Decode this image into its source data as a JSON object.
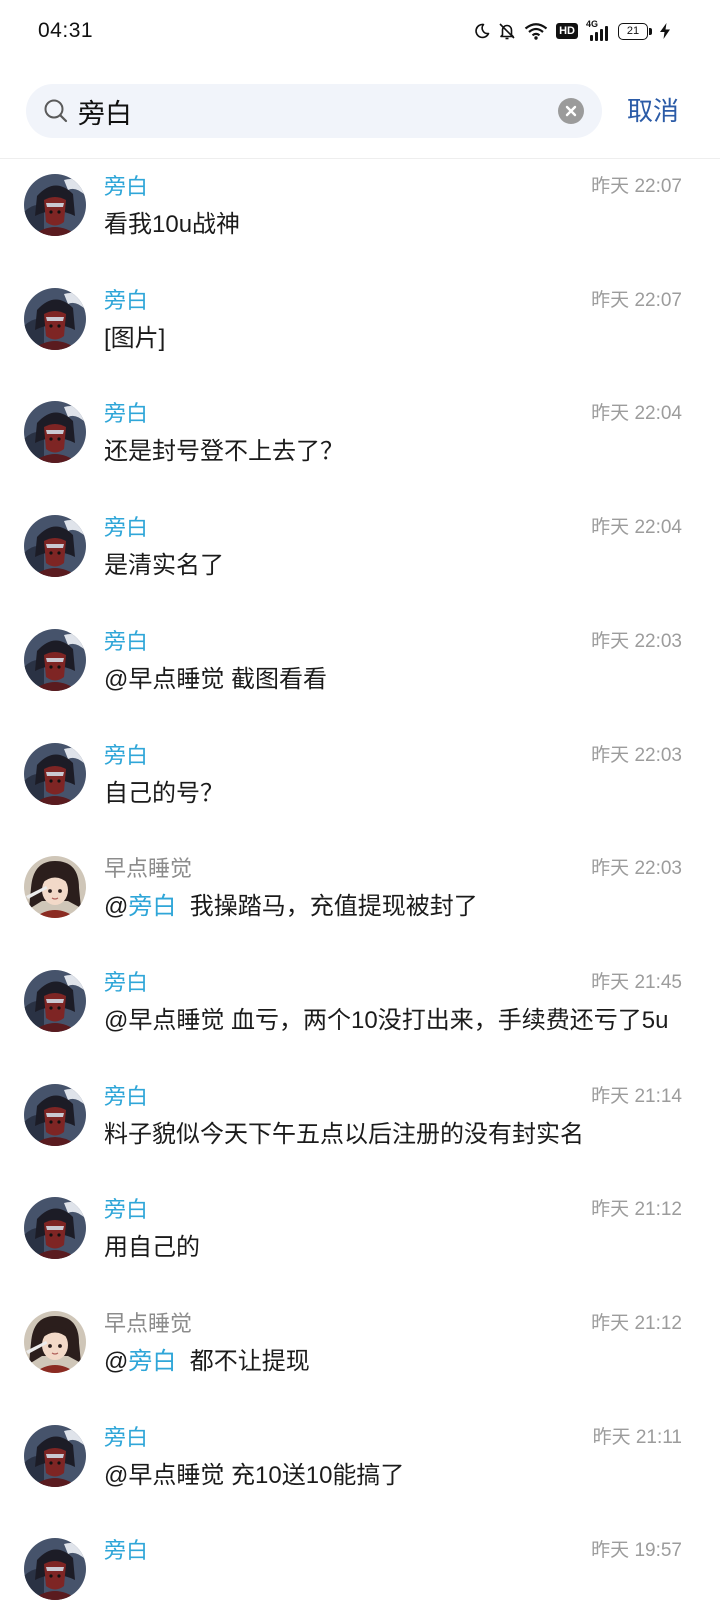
{
  "status_bar": {
    "time": "04:31",
    "hd_label": "HD",
    "network_label": "4G",
    "battery": "21"
  },
  "search": {
    "query": "旁白",
    "cancel_label": "取消"
  },
  "colors": {
    "keyword_highlight": "#2fa6d8",
    "cancel": "#2b5ba7",
    "search_background": "#f1f4fa"
  },
  "messages": [
    {
      "avatar": "pangbai-avatar",
      "sender": "旁白",
      "sender_highlight": true,
      "time": "昨天 22:07",
      "text_parts": [
        {
          "text": "看我10u战神"
        }
      ]
    },
    {
      "avatar": "pangbai-avatar",
      "sender": "旁白",
      "sender_highlight": true,
      "time": "昨天 22:07",
      "text_parts": [
        {
          "text": "[图片]"
        }
      ]
    },
    {
      "avatar": "pangbai-avatar",
      "sender": "旁白",
      "sender_highlight": true,
      "time": "昨天 22:04",
      "text_parts": [
        {
          "text": "还是封号登不上去了？"
        }
      ]
    },
    {
      "avatar": "pangbai-avatar",
      "sender": "旁白",
      "sender_highlight": true,
      "time": "昨天 22:04",
      "text_parts": [
        {
          "text": "是清实名了"
        }
      ]
    },
    {
      "avatar": "pangbai-avatar",
      "sender": "旁白",
      "sender_highlight": true,
      "time": "昨天 22:03",
      "text_parts": [
        {
          "text": "@早点睡觉 截图看看"
        }
      ]
    },
    {
      "avatar": "pangbai-avatar",
      "sender": "旁白",
      "sender_highlight": true,
      "time": "昨天 22:03",
      "text_parts": [
        {
          "text": "自己的号？"
        }
      ]
    },
    {
      "avatar": "zaodian-avatar",
      "sender": "早点睡觉",
      "sender_highlight": false,
      "time": "昨天 22:03",
      "text_parts": [
        {
          "text": "@"
        },
        {
          "text": "旁白",
          "highlight": true
        },
        {
          "text": "  我操踏马，充值提现被封了"
        }
      ]
    },
    {
      "avatar": "pangbai-avatar",
      "sender": "旁白",
      "sender_highlight": true,
      "time": "昨天 21:45",
      "text_parts": [
        {
          "text": "@早点睡觉 血亏，两个10没打出来，手续费还亏了5u"
        }
      ]
    },
    {
      "avatar": "pangbai-avatar",
      "sender": "旁白",
      "sender_highlight": true,
      "time": "昨天 21:14",
      "text_parts": [
        {
          "text": "料子貌似今天下午五点以后注册的没有封实名"
        }
      ]
    },
    {
      "avatar": "pangbai-avatar",
      "sender": "旁白",
      "sender_highlight": true,
      "time": "昨天 21:12",
      "text_parts": [
        {
          "text": "用自己的"
        }
      ]
    },
    {
      "avatar": "zaodian-avatar",
      "sender": "早点睡觉",
      "sender_highlight": false,
      "time": "昨天 21:12",
      "text_parts": [
        {
          "text": "@"
        },
        {
          "text": "旁白",
          "highlight": true
        },
        {
          "text": "  都不让提现"
        }
      ]
    },
    {
      "avatar": "pangbai-avatar",
      "sender": "旁白",
      "sender_highlight": true,
      "time": "昨天 21:11",
      "text_parts": [
        {
          "text": "@早点睡觉 充10送10能搞了"
        }
      ]
    },
    {
      "avatar": "pangbai-avatar",
      "sender": "旁白",
      "sender_highlight": true,
      "time": "昨天 19:57",
      "text_parts": []
    }
  ]
}
